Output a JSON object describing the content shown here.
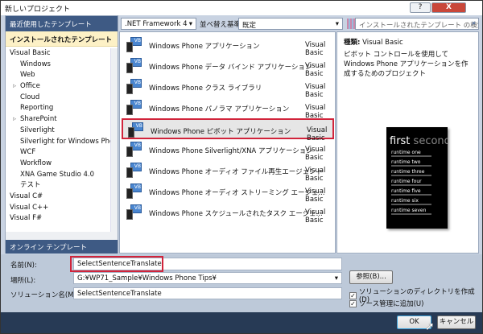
{
  "window": {
    "title": "新しいプロジェクト",
    "help": "?",
    "close": "X"
  },
  "left": {
    "recent": "最近使用したテンプレート",
    "installed": "インストールされたテンプレート",
    "tree": [
      {
        "label": "Visual Basic",
        "indent": 0,
        "expander": false
      },
      {
        "label": "Windows",
        "indent": 1,
        "expander": false
      },
      {
        "label": "Web",
        "indent": 1,
        "expander": false
      },
      {
        "label": "Office",
        "indent": 1,
        "expander": true
      },
      {
        "label": "Cloud",
        "indent": 1,
        "expander": false
      },
      {
        "label": "Reporting",
        "indent": 1,
        "expander": false
      },
      {
        "label": "SharePoint",
        "indent": 1,
        "expander": true
      },
      {
        "label": "Silverlight",
        "indent": 1,
        "expander": false
      },
      {
        "label": "Silverlight for Windows Phone",
        "indent": 1,
        "expander": false
      },
      {
        "label": "WCF",
        "indent": 1,
        "expander": false
      },
      {
        "label": "Workflow",
        "indent": 1,
        "expander": false
      },
      {
        "label": "XNA Game Studio 4.0",
        "indent": 1,
        "expander": false
      },
      {
        "label": "テスト",
        "indent": 1,
        "expander": false
      },
      {
        "label": "Visual C#",
        "indent": 0,
        "expander": false
      },
      {
        "label": "Visual C++",
        "indent": 0,
        "expander": false
      },
      {
        "label": "Visual F#",
        "indent": 0,
        "expander": false
      }
    ],
    "online": "オンライン テンプレート"
  },
  "toolbar": {
    "framework": ".NET Framework 4",
    "sort_label": "並べ替え基準:",
    "sort_value": "既定",
    "search_placeholder": "インストールされたテンプレート の検索"
  },
  "templates": [
    {
      "name": "Windows Phone アプリケーション",
      "lang": "Visual Basic"
    },
    {
      "name": "Windows Phone データ バインド アプリケーション",
      "lang": "Visual Basic"
    },
    {
      "name": "Windows Phone クラス ライブラリ",
      "lang": "Visual Basic"
    },
    {
      "name": "Windows Phone パノラマ アプリケーション",
      "lang": "Visual Basic"
    },
    {
      "name": "Windows Phone ピボット アプリケーション",
      "lang": "Visual Basic",
      "selected": true
    },
    {
      "name": "Windows Phone Silverlight/XNA アプリケーション",
      "lang": "Visual Basic"
    },
    {
      "name": "Windows Phone オーディオ ファイル再生エージェント",
      "lang": "Visual Basic"
    },
    {
      "name": "Windows Phone オーディオ ストリーミング エージェ...",
      "lang": "Visual Basic"
    },
    {
      "name": "Windows Phone スケジュールされたタスク エージェ...",
      "lang": "Visual Basic"
    }
  ],
  "details": {
    "type_label": "種類:",
    "type_value": "Visual Basic",
    "description": "ピボット コントロールを使用して Windows Phone アプリケーションを作成するためのプロジェクト",
    "preview": {
      "title_first": "first",
      "title_second": "second",
      "items": [
        "runtime one",
        "runtime two",
        "runtime three",
        "runtime four",
        "runtime five",
        "runtime six",
        "runtime seven"
      ]
    }
  },
  "form": {
    "name_label": "名前(N):",
    "name_value": "SelectSentenceTranslate",
    "location_label": "場所(L):",
    "location_value": "G:¥WP71_Sample¥Windows Phone Tips¥",
    "browse": "参照(B)...",
    "solution_label": "ソリューション名(M):",
    "solution_value": "SelectSentenceTranslate",
    "create_dir": "ソリューションのディレクトリを作成(D)",
    "add_source": "ソース管理に追加(U)",
    "ok": "OK",
    "cancel": "キャンセル"
  }
}
